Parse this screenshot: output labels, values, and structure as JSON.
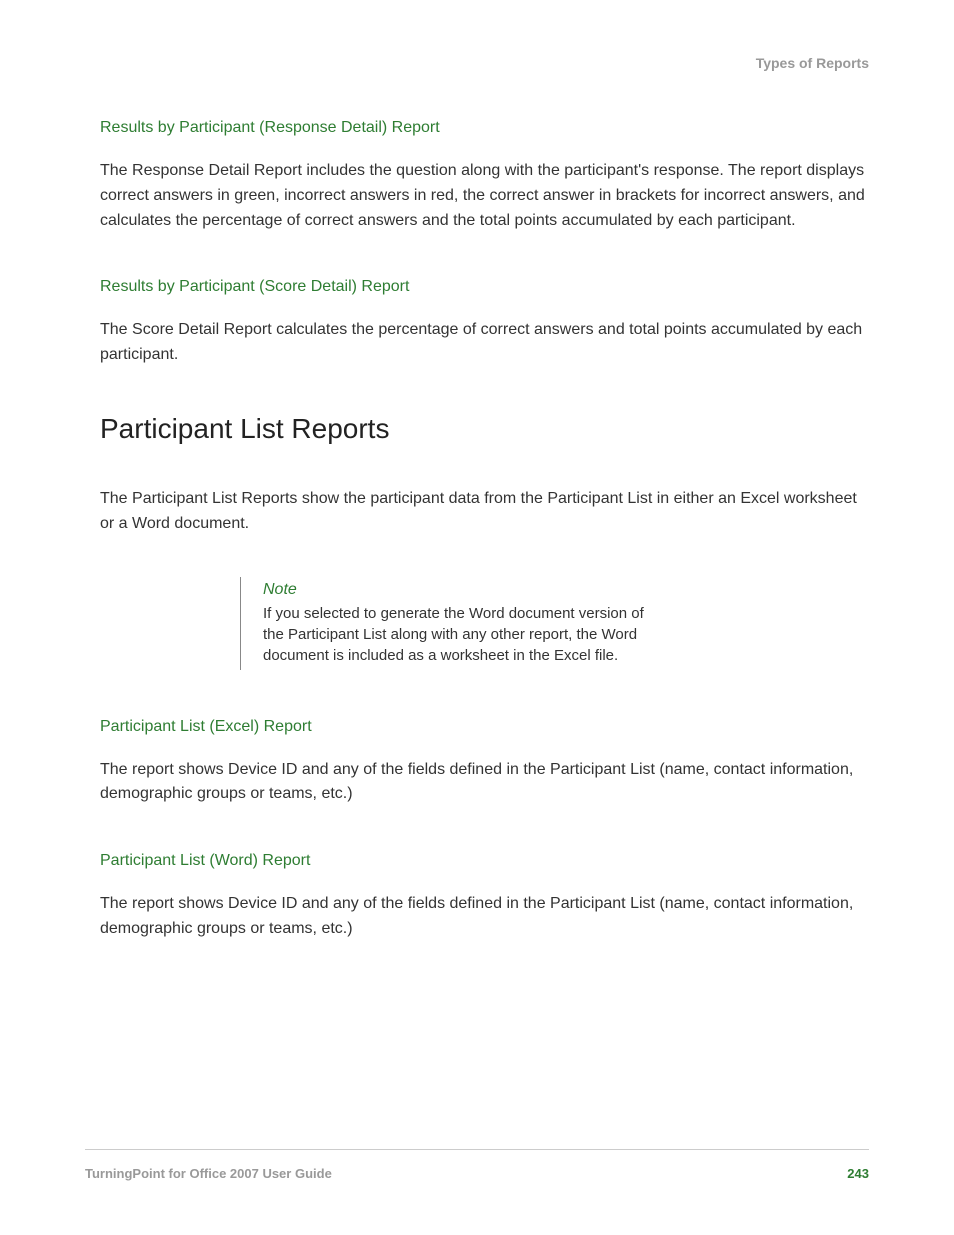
{
  "header": {
    "title": "Types of Reports"
  },
  "sections": {
    "responseDetail": {
      "heading": "Results by Participant (Response Detail) Report",
      "body": "The Response Detail Report includes the question along with the participant's response. The report displays correct answers in green, incorrect answers in red, the correct answer in brackets for incorrect answers, and calculates the percentage of correct answers and the total points accumulated by each participant."
    },
    "scoreDetail": {
      "heading": "Results by Participant (Score Detail) Report",
      "body": "The Score Detail Report calculates the percentage of correct answers and total points accumulated by each participant."
    },
    "participantListReports": {
      "title": "Participant List Reports",
      "intro": "The Participant List Reports show the participant data from the Participant List in either an Excel worksheet or a Word document.",
      "note": {
        "label": "Note",
        "text": "If you selected to generate the Word document version of the Participant List along with any other report, the Word document is included as a worksheet in the Excel file."
      },
      "excel": {
        "heading": "Participant List (Excel) Report",
        "body": "The report shows Device ID and any of the fields defined in the Participant List (name, contact information, demographic groups or teams, etc.)"
      },
      "word": {
        "heading": "Participant List (Word) Report",
        "body": "The report shows Device ID and any of the fields defined in the Participant List (name, contact information, demographic groups or teams, etc.)"
      }
    }
  },
  "footer": {
    "guide": "TurningPoint for Office 2007 User Guide",
    "page": "243"
  }
}
